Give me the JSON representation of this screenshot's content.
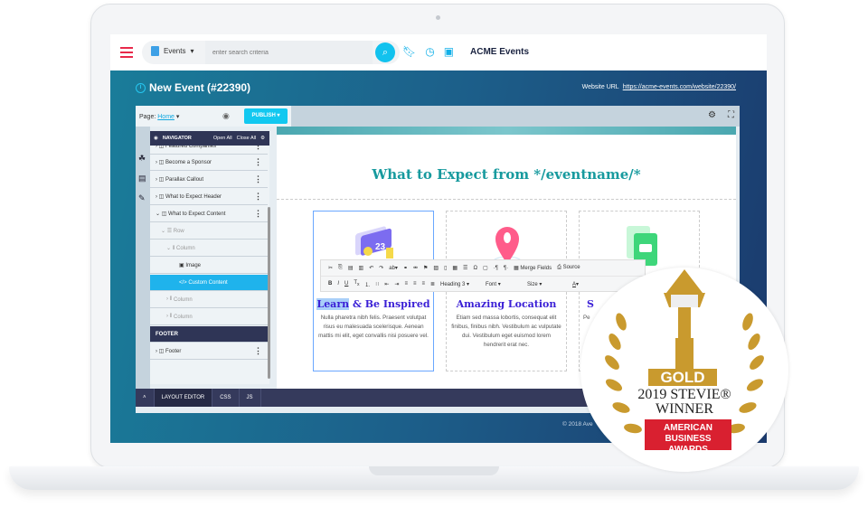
{
  "topbar": {
    "module": "Events",
    "search_placeholder": "enter search criteria",
    "brand": "ACME Events"
  },
  "header": {
    "title": "New Event (#22390)",
    "url_label": "Website URL",
    "url": "https://acme-events.com/website/22390/"
  },
  "editor": {
    "page_label": "Page:",
    "page_value": "Home",
    "publish": "PUBLISH"
  },
  "navigator": {
    "title": "NAVIGATOR",
    "open_all": "Open All",
    "close_all": "Close All",
    "items": [
      {
        "label": "Featured Companies"
      },
      {
        "label": "Become a Sponsor"
      },
      {
        "label": "Parallax Callout"
      },
      {
        "label": "What to Expect Header"
      },
      {
        "label": "What to Expect Content"
      },
      {
        "label": "Row"
      },
      {
        "label": "Column"
      },
      {
        "label": "Image"
      },
      {
        "label": "Custom Content"
      },
      {
        "label": "Column"
      },
      {
        "label": "Column"
      },
      {
        "label": "FOOTER"
      },
      {
        "label": "Footer"
      }
    ]
  },
  "tabs": [
    "LAYOUT EDITOR",
    "CSS",
    "JS"
  ],
  "canvas": {
    "heading": "What to Expect from */eventname/*",
    "cols": [
      {
        "title_hl": "Learn",
        "title_rest": " & Be Inspired",
        "text": "Nulla pharetra nibh felis. Praesent volutpat risus eu malesuada scelerisque. Aenean mattis mi elit, eget convallis nisi posuere vel."
      },
      {
        "title": "Amazing Location",
        "text": "Etiam sed massa lobortis, consequat elit finibus, finibus nibh. Vestibulum ac vulputate dui. Vestibulum eget euismod lorem hendrerit erat nec."
      },
      {
        "title": "S",
        "text": "Pe"
      }
    ]
  },
  "rte": {
    "merge_fields": "Merge Fields",
    "source": "Source",
    "format": "Heading 3",
    "font": "Font",
    "size": "Size"
  },
  "footer": {
    "copyright": "© 2018 Ave"
  },
  "badge": {
    "gold": "GOLD",
    "line1": "2019 STEVIE® ",
    "line2": "WINNER",
    "line3": "AMERICAN",
    "line4": "BUSINESS AWARDS"
  }
}
